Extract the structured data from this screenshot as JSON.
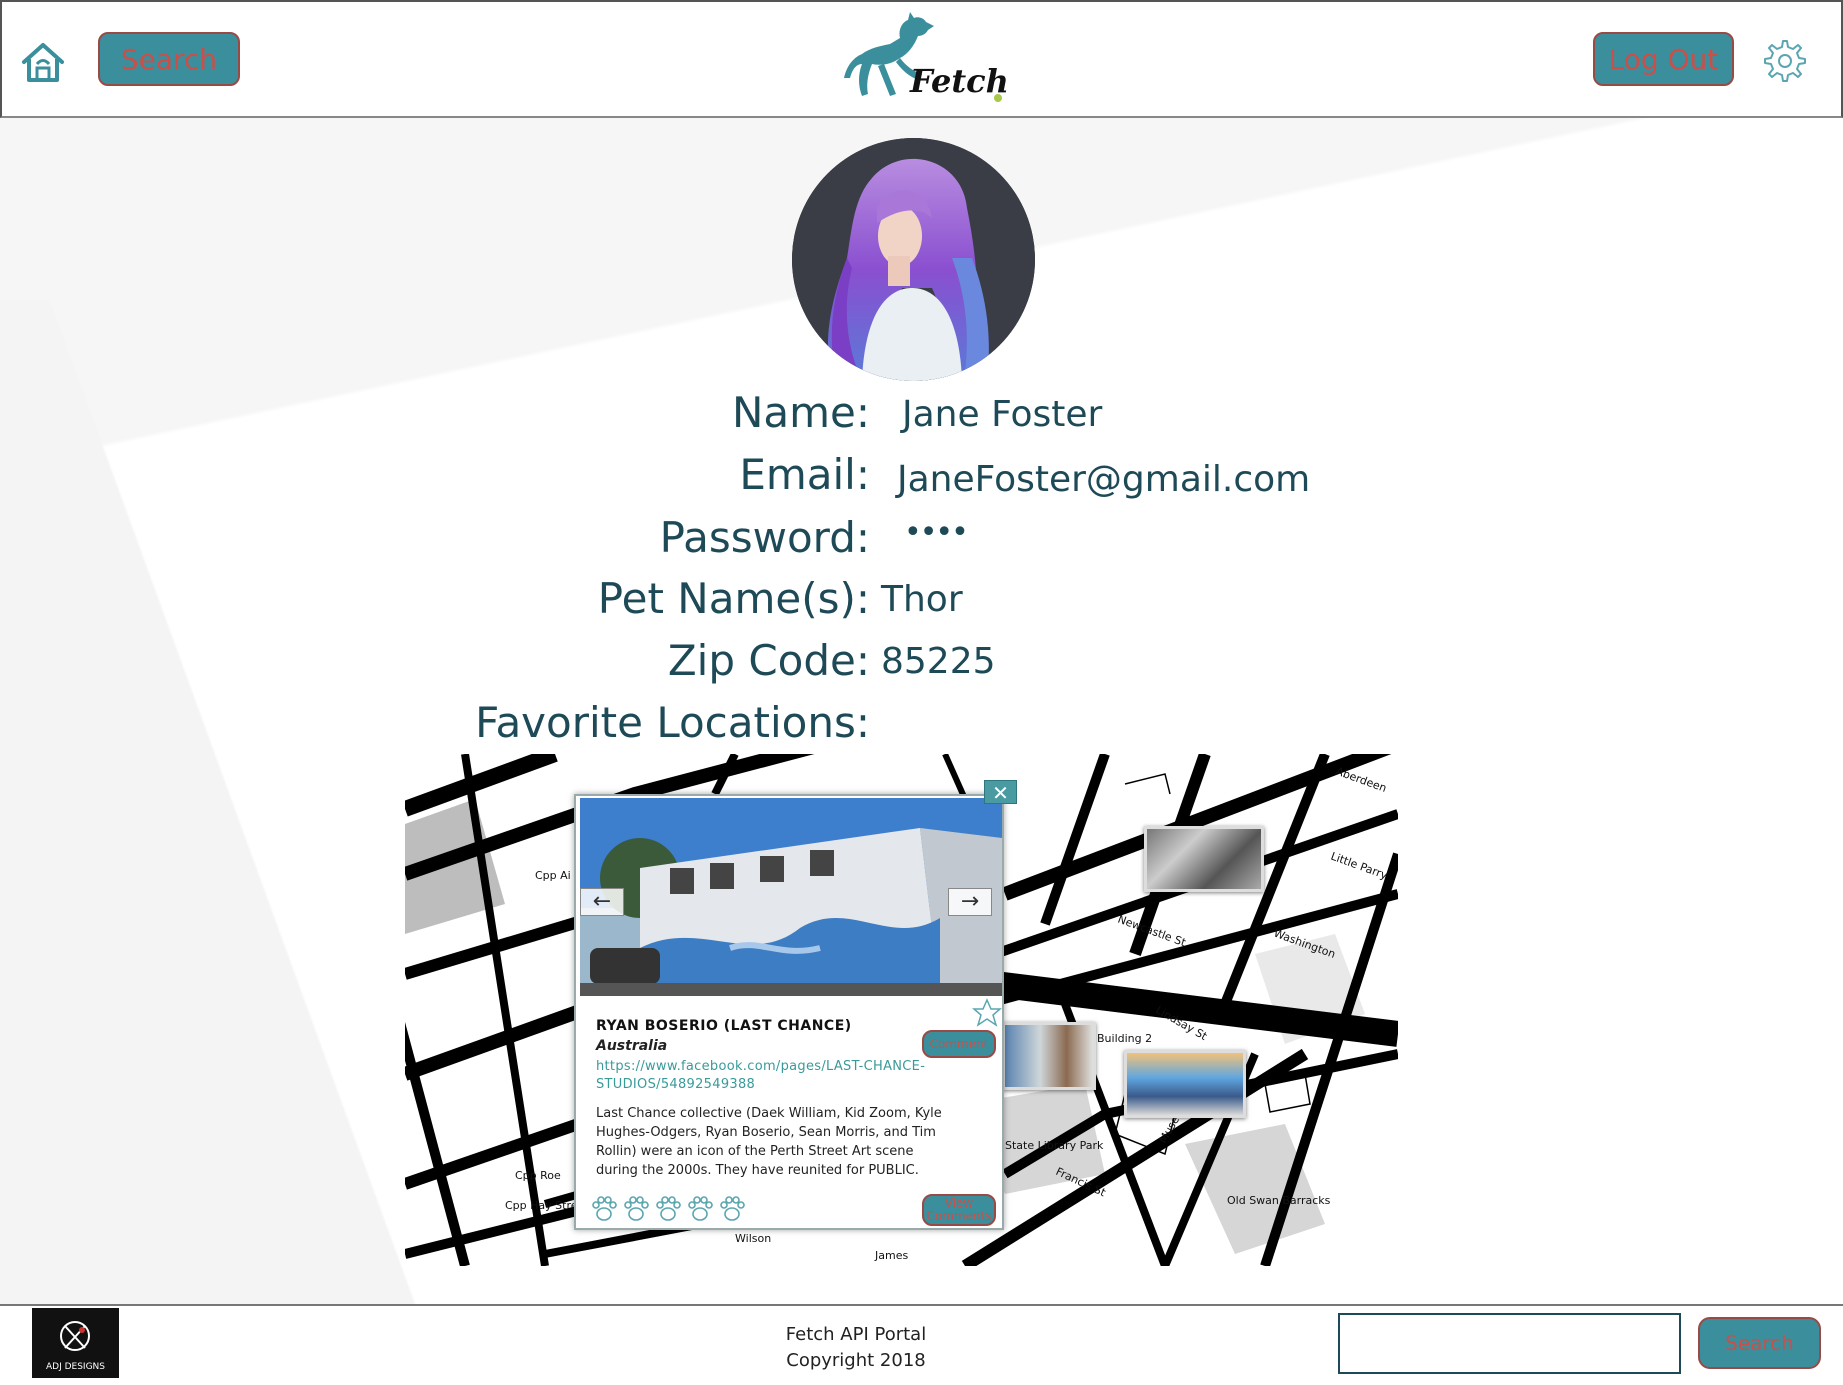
{
  "header": {
    "search_label": "Search",
    "logout_label": "Log Out",
    "logo_text": "Fetch"
  },
  "profile": {
    "fields": [
      {
        "label": "Name:",
        "value": "Jane Foster"
      },
      {
        "label": "Email:",
        "value": "JaneFoster@gmail.com"
      },
      {
        "label": "Password:",
        "value": "••••"
      },
      {
        "label": "Pet Name(s):",
        "value": "Thor"
      },
      {
        "label": "Zip Code:",
        "value": "85225"
      },
      {
        "label": "Favorite Locations:",
        "value": ""
      }
    ]
  },
  "map": {
    "street_labels": [
      "Cpp Ai Street",
      "Newcastle St",
      "Washington",
      "Building 2",
      "Old Swan Barracks",
      "Cpp Hay Street East Carpark",
      "Cpp Roe",
      "Wilson",
      "James",
      "Little Parry",
      "Aberdeen",
      "Lindsay St",
      "Museum St",
      "Francis St",
      "State Library Park"
    ],
    "popup": {
      "close": "✕",
      "prev": "←",
      "next": "→",
      "title": "RYAN BOSERIO (LAST CHANCE)",
      "subtitle": "Australia",
      "link": "https://www.facebook.com/pages/LAST-CHANCE-STUDIOS/54892549388",
      "description": "Last Chance collective (Daek William, Kid Zoom, Kyle Hughes-Odgers, Ryan Boserio, Sean Morris, and Tim Rollin) were an icon of the Perth Street Art scene during the 2000s. They have reunited for PUBLIC.",
      "comment_label": "Comment",
      "view_comments_label": "View Comments",
      "paw_rating": 5
    }
  },
  "footer": {
    "logo_text": "ADJ DESIGNS",
    "line1": "Fetch API Portal",
    "line2": "Copyright 2018",
    "search_value": "",
    "search_label": "Search"
  },
  "colors": {
    "teal": "#3b8f9c",
    "button_text": "#c9504a",
    "text": "#1e4a57"
  }
}
